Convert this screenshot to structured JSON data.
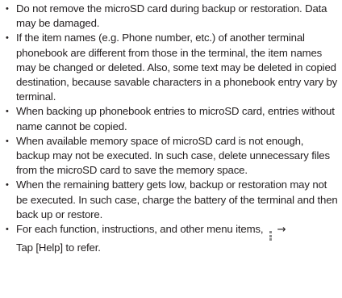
{
  "notes": [
    "Do not remove the microSD card during backup or restoration. Data may be damaged.",
    "If the item names (e.g. Phone number, etc.) of another terminal phonebook are different from those in the terminal, the item names may be changed or deleted. Also, some text may be deleted in copied destination, because savable characters in a phonebook entry vary by terminal.",
    "When backing up phonebook entries to microSD card, entries without name cannot be copied.",
    "When available memory space of microSD card is not enough, backup may not be executed. In such case, delete unnecessary files from the microSD card to save the memory space.",
    "When the remaining battery gets low, backup or restoration may not be executed. In such case, charge the battery of the terminal and then back up or restore."
  ],
  "last_note": {
    "text_before_icon": "For each function, instructions, and other menu items,",
    "icon": "vertical-ellipsis-menu-icon",
    "arrow": "→",
    "text_after_icon": "Tap [Help] to refer."
  },
  "bullet_glyph": "•"
}
